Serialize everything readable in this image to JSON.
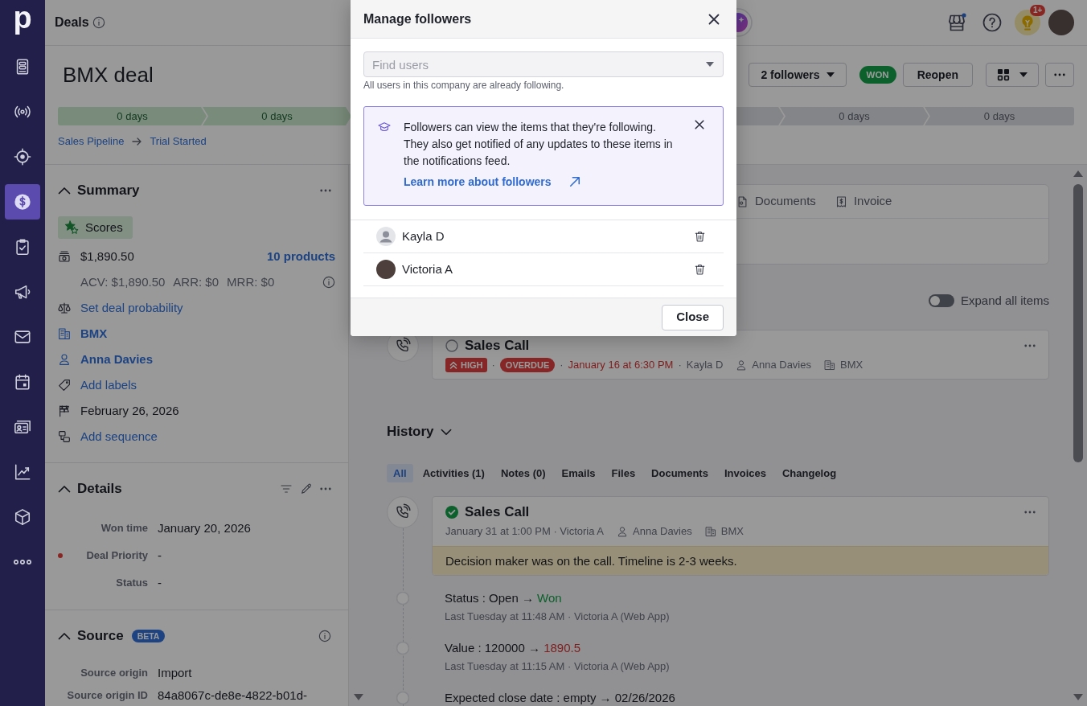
{
  "nav": {
    "logo": "p",
    "items": [
      {
        "selected": false
      },
      {
        "selected": false
      },
      {
        "selected": false
      },
      {
        "selected": true
      },
      {
        "selected": false
      },
      {
        "selected": false
      },
      {
        "selected": false
      },
      {
        "selected": false
      },
      {
        "selected": false
      },
      {
        "selected": false
      },
      {
        "selected": false
      },
      {
        "selected": false
      }
    ]
  },
  "top_bar": {
    "title": "Deals",
    "notifications_badge": "1+"
  },
  "deal": {
    "title": "BMX deal",
    "followers_button": "2 followers",
    "status_badge": "WON",
    "reopen_button": "Reopen",
    "stages": [
      {
        "kind": "full",
        "label": "0 days",
        "reached": true
      },
      {
        "kind": "full",
        "label": "0 days",
        "reached": true
      },
      {
        "kind": "cut",
        "reached": false
      },
      {
        "kind": "full",
        "label": "0 days",
        "reached": false
      },
      {
        "kind": "full",
        "label": "0 days",
        "reached": false
      }
    ],
    "breadcrumb": [
      "Sales Pipeline",
      "Trial Started"
    ]
  },
  "summary": {
    "title": "Summary",
    "scores_button": "Scores",
    "value": "$1,890.50",
    "products_link": "10 products",
    "recurring": [
      "ACV: $1,890.50",
      "ARR: $0",
      "MRR: $0"
    ],
    "rows": [
      {
        "kind": "link",
        "text": "Set deal probability"
      },
      {
        "kind": "entity",
        "text": "BMX"
      },
      {
        "kind": "entity",
        "text": "Anna Davies"
      },
      {
        "kind": "link",
        "text": "Add labels"
      },
      {
        "kind": "text",
        "text": "February 26, 2026"
      },
      {
        "kind": "link",
        "text": "Add sequence"
      }
    ]
  },
  "details": {
    "title": "Details",
    "fields": [
      {
        "name": "Won time",
        "value": "January 20, 2026",
        "required": false
      },
      {
        "name": "Deal Priority",
        "value": "-",
        "required": true
      },
      {
        "name": "Status",
        "value": "-",
        "required": false
      }
    ]
  },
  "source": {
    "title": "Source",
    "badge": "BETA",
    "fields": [
      {
        "name": "Source origin",
        "value": "Import"
      },
      {
        "name": "Source origin ID",
        "value": "84a8067c-de8e-4822-b01d-"
      }
    ]
  },
  "activity_tabs": [
    {
      "label": "Documents",
      "selected": false
    },
    {
      "label": "Invoice",
      "selected": false
    }
  ],
  "expand_all": {
    "label": "Expand all items",
    "on": false
  },
  "focus_activity": {
    "title": "Sales Call",
    "done": false,
    "meta": [
      {
        "kind": "priority",
        "text": "HIGH"
      },
      {
        "kind": "separator",
        "text": "·"
      },
      {
        "kind": "badge",
        "text": "OVERDUE"
      },
      {
        "kind": "separator",
        "text": "·"
      },
      {
        "kind": "due",
        "text": "January 16 at 6:30 PM"
      },
      {
        "kind": "separator",
        "text": "·"
      },
      {
        "kind": "plain",
        "text": "Kayla D"
      },
      {
        "kind": "person",
        "text": "Anna Davies"
      },
      {
        "kind": "organization",
        "text": "BMX"
      }
    ]
  },
  "history": {
    "title": "History",
    "filters": [
      {
        "label": "All",
        "selected": true
      },
      {
        "label": "Activities (1)",
        "selected": false
      },
      {
        "label": "Notes (0)",
        "selected": false
      },
      {
        "label": "Emails",
        "selected": false
      },
      {
        "label": "Files",
        "selected": false
      },
      {
        "label": "Documents",
        "selected": false
      },
      {
        "label": "Invoices",
        "selected": false
      },
      {
        "label": "Changelog",
        "selected": false
      }
    ],
    "activity": {
      "title": "Sales Call",
      "done": true,
      "meta": [
        {
          "kind": "plain",
          "text": "January 31 at 1:00 PM · Victoria A"
        },
        {
          "kind": "person",
          "text": "Anna Davies"
        },
        {
          "kind": "organization",
          "text": "BMX"
        }
      ],
      "note": "Decision maker was on the call. Timeline is 2-3 weeks."
    },
    "changes": [
      {
        "kind": "positive",
        "text": "Status : Open →",
        "new_value": "Won",
        "meta": "Last Tuesday at 11:48 AM · Victoria A (Web App)"
      },
      {
        "kind": "negative",
        "text": "Value : 120000 →",
        "new_value": "1890.5",
        "meta": "Last Tuesday at 11:15 AM · Victoria A (Web App)"
      },
      {
        "kind": "neutral",
        "text": "Expected close date : empty →",
        "new_value": "02/26/2026"
      }
    ]
  },
  "followers_dialog": {
    "title": "Manage followers",
    "search": {
      "placeholder": "Find users"
    },
    "hint": "All users in this company are already following.",
    "info": {
      "text": "Followers can view the items that they're following. They also get notified of any updates to these items in the notifications feed.",
      "link": "Learn more about followers"
    },
    "followers": [
      {
        "kind": "placeholder",
        "name": "Kayla D"
      },
      {
        "kind": "photo",
        "name": "Victoria A"
      }
    ],
    "close_button": "Close"
  }
}
